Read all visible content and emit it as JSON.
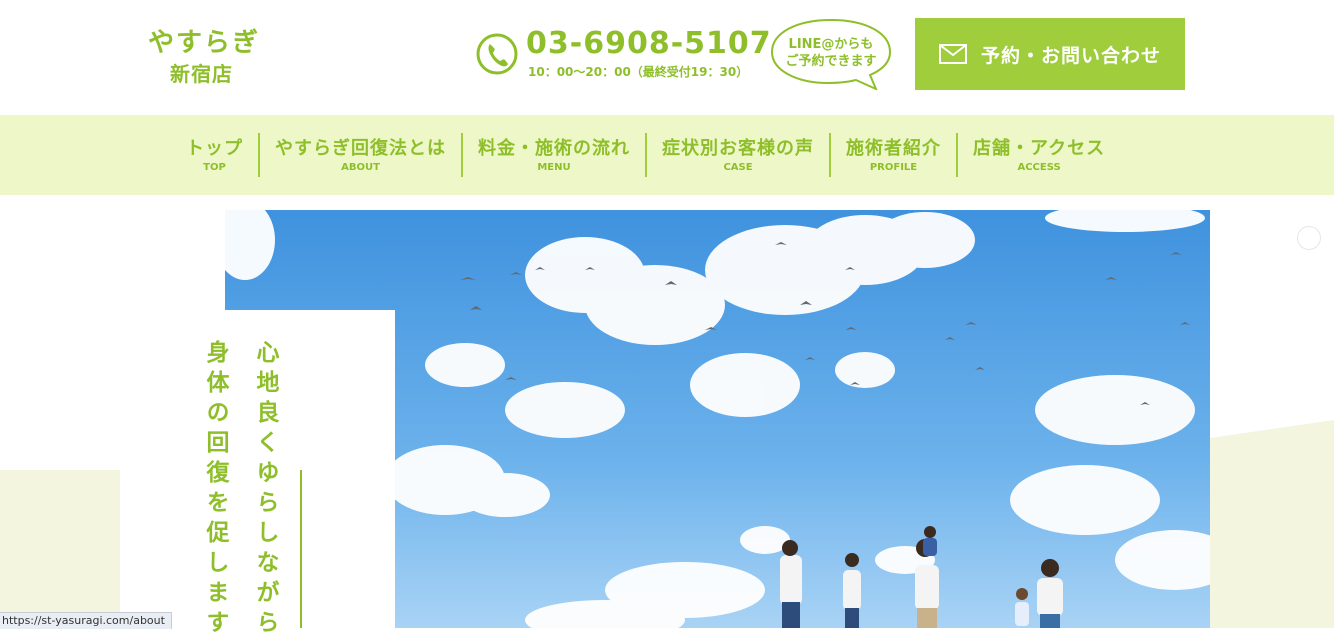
{
  "logo": {
    "line1": "やすらぎ",
    "line2": "新宿店"
  },
  "contact": {
    "phone": "03-6908-5107",
    "hours": "10：00〜20：00（最終受付19：30）",
    "line_label_1": "LINE@からも",
    "line_label_2": "ご予約できます"
  },
  "cta": {
    "label": "予約・お問い合わせ"
  },
  "nav": {
    "items": [
      {
        "ja": "トップ",
        "en": "TOP"
      },
      {
        "ja": "やすらぎ回復法とは",
        "en": "ABOUT"
      },
      {
        "ja": "料金・施術の流れ",
        "en": "MENU"
      },
      {
        "ja": "症状別お客様の声",
        "en": "CASE"
      },
      {
        "ja": "施術者紹介",
        "en": "PROFILE"
      },
      {
        "ja": "店舗・アクセス",
        "en": "ACCESS"
      }
    ]
  },
  "hero": {
    "tagline_line1": "心地良くゆらしながら",
    "tagline_line2": "身体の回復を促します"
  },
  "status_bar": {
    "url": "https://st-yasuragi.com/about"
  },
  "colors": {
    "accent": "#9fcd3c",
    "text_green": "#8ebf2a",
    "nav_bg": "#eef7c8",
    "sky": "#4a9be0"
  },
  "icons": [
    "phone-icon",
    "mail-icon",
    "speech-bubble-icon"
  ]
}
